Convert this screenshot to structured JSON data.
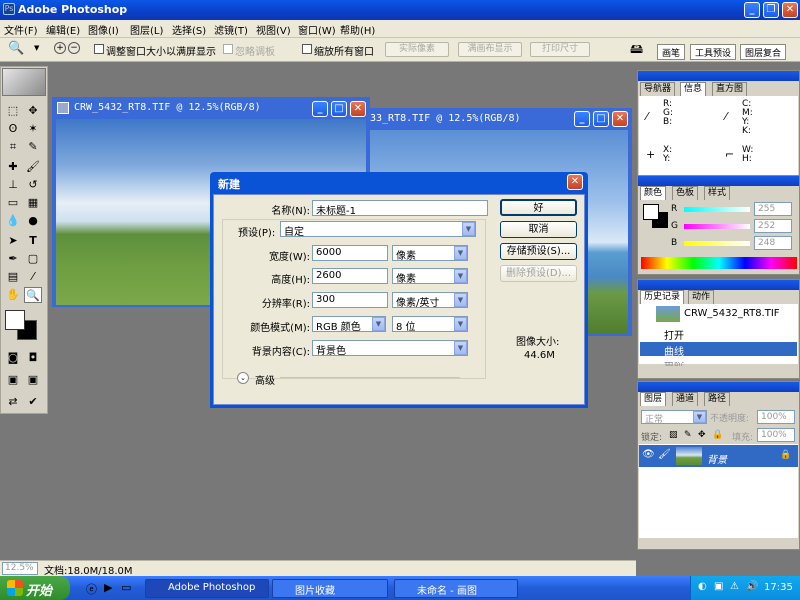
{
  "app": {
    "title": "Adobe Photoshop"
  },
  "menu": [
    "文件(F)",
    "编辑(E)",
    "图像(I)",
    "图层(L)",
    "选择(S)",
    "滤镜(T)",
    "视图(V)",
    "窗口(W)",
    "帮助(H)"
  ],
  "options": {
    "resize_windows": "调整窗口大小以满屏显示",
    "ignore_palettes": "忽略调板",
    "zoom_all": "缩放所有窗口",
    "actual_pixels": "实际像素",
    "fit_on_screen": "满画布显示",
    "print_size": "打印尺寸",
    "palette_tabs": [
      "画笔",
      "工具预设",
      "图层复合"
    ]
  },
  "doc_windows": [
    {
      "title": "CRW_5432_RT8.TIF @ 12.5%(RGB/8)"
    },
    {
      "title": "33_RT8.TIF @ 12.5%(RGB/8)"
    }
  ],
  "dialog": {
    "title": "新建",
    "name_label": "名称(N):",
    "name_value": "未标题-1",
    "preset_label": "预设(P):",
    "preset_value": "自定",
    "width_label": "宽度(W):",
    "width_value": "6000",
    "width_unit": "像素",
    "height_label": "高度(H):",
    "height_value": "2600",
    "height_unit": "像素",
    "resolution_label": "分辨率(R):",
    "resolution_value": "300",
    "resolution_unit": "像素/英寸",
    "color_mode_label": "颜色模式(M):",
    "color_mode_value": "RGB 颜色",
    "bit_depth": "8 位",
    "background_label": "背景内容(C):",
    "background_value": "背景色",
    "advanced": "高级",
    "image_size_label": "图像大小:",
    "image_size_value": "44.6M",
    "buttons": {
      "ok": "好",
      "cancel": "取消",
      "save_preset": "存储预设(S)...",
      "delete_preset": "删除预设(D)..."
    }
  },
  "navigator": {
    "tabs": [
      "导航器",
      "信息",
      "直方图"
    ],
    "rgb": [
      "R:",
      "G:",
      "B:"
    ],
    "cmyk": [
      "C:",
      "M:",
      "Y:",
      "K:"
    ],
    "xy": [
      "X:",
      "Y:"
    ],
    "wh": [
      "W:",
      "H:"
    ]
  },
  "color": {
    "tabs": [
      "颜色",
      "色板",
      "样式"
    ],
    "r_label": "R",
    "r_value": "255",
    "g_label": "G",
    "g_value": "252",
    "b_label": "B",
    "b_value": "248"
  },
  "history": {
    "tabs": [
      "历史记录",
      "动作"
    ],
    "snapshot": "CRW_5432_RT8.TIF",
    "items": [
      "打开",
      "曲线",
      "色阶"
    ]
  },
  "layers": {
    "tabs": [
      "图层",
      "通道",
      "路径"
    ],
    "blend_mode": "正常",
    "opacity_label": "不透明度:",
    "opacity_value": "100%",
    "lock_label": "锁定:",
    "fill_label": "填充:",
    "fill_value": "100%",
    "layer_name": "背景"
  },
  "status": {
    "zoom": "12.5%",
    "doc": "文档:18.0M/18.0M"
  },
  "taskbar": {
    "start": "开始",
    "tasks": [
      "Adobe Photoshop",
      "图片收藏",
      "未命名 - 画图"
    ],
    "clock": "17:35"
  },
  "colors": {
    "accent": "#0a52d6",
    "dialog_bg": "#ece9d8",
    "workspace": "#787878",
    "selected": "#316ac5"
  }
}
